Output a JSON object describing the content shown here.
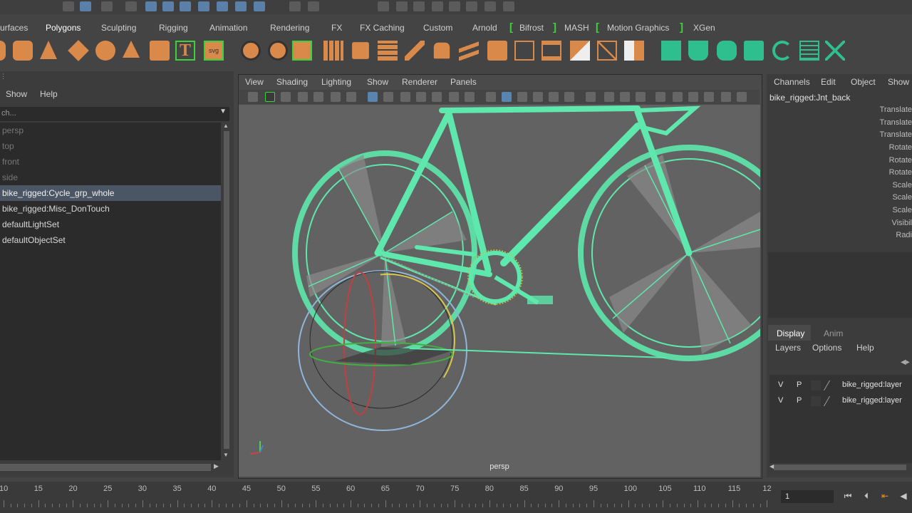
{
  "shelf": {
    "tabs": [
      "urfaces",
      "Polygons",
      "Sculpting",
      "Rigging",
      "Animation",
      "Rendering",
      "FX",
      "FX Caching",
      "Custom",
      "Arnold",
      "Bifrost",
      "MASH",
      "Motion Graphics",
      "XGen"
    ],
    "active_tab": "Polygons"
  },
  "outliner": {
    "menu": [
      "Show",
      "Help"
    ],
    "search_placeholder": "ch...",
    "items": [
      {
        "label": "persp",
        "dim": true
      },
      {
        "label": "top",
        "dim": true
      },
      {
        "label": "front",
        "dim": true
      },
      {
        "label": "side",
        "dim": true
      },
      {
        "label": "bike_rigged:Cycle_grp_whole",
        "dim": false
      },
      {
        "label": "bike_rigged:Misc_DonTouch",
        "dim": false
      },
      {
        "label": "defaultLightSet",
        "dim": false
      },
      {
        "label": "defaultObjectSet",
        "dim": false
      }
    ],
    "selected_index": 4
  },
  "viewport": {
    "menu": [
      "View",
      "Shading",
      "Lighting",
      "Show",
      "Renderer",
      "Panels"
    ],
    "camera_label": "persp",
    "model_color": "#5ee8ad"
  },
  "channel_box": {
    "menu": [
      "Channels",
      "Edit",
      "Object",
      "Show"
    ],
    "object_name": "bike_rigged:Jnt_back",
    "attributes": [
      "Translate",
      "Translate",
      "Translate",
      "Rotate",
      "Rotate",
      "Rotate",
      "Scale",
      "Scale",
      "Scale",
      "Visibil",
      "Radi"
    ]
  },
  "layer_editor": {
    "tabs": [
      "Display",
      "Anim"
    ],
    "menu": [
      "Layers",
      "Options",
      "Help"
    ],
    "layers": [
      {
        "v": "V",
        "p": "P",
        "name": "bike_rigged:layer"
      },
      {
        "v": "V",
        "p": "P",
        "name": "bike_rigged:layer"
      }
    ]
  },
  "time_slider": {
    "ticks": [
      "10",
      "15",
      "20",
      "25",
      "30",
      "35",
      "40",
      "45",
      "50",
      "55",
      "60",
      "65",
      "70",
      "75",
      "80",
      "85",
      "90",
      "95",
      "100",
      "105",
      "110",
      "115",
      "12"
    ],
    "current_frame": "1"
  },
  "colors": {
    "accent_green": "#3cd23c",
    "icon_orange": "#d9894a",
    "selection": "#4b5665"
  }
}
